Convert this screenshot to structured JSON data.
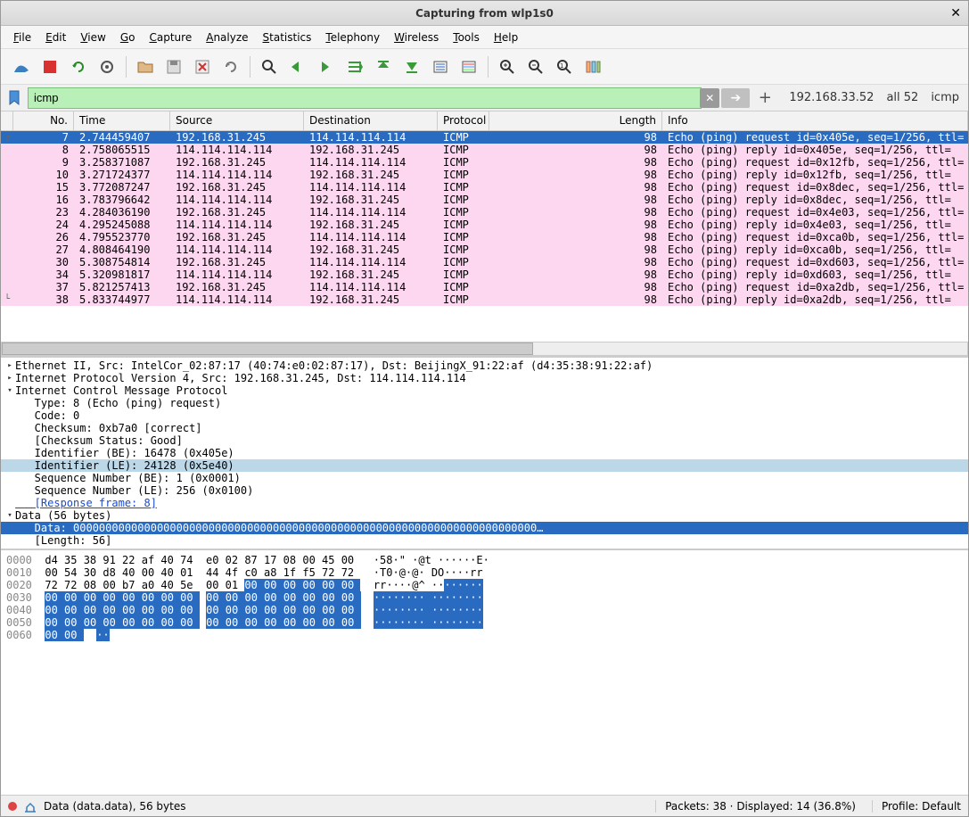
{
  "window": {
    "title": "Capturing from wlp1s0"
  },
  "menu": [
    "File",
    "Edit",
    "View",
    "Go",
    "Capture",
    "Analyze",
    "Statistics",
    "Telephony",
    "Wireless",
    "Tools",
    "Help"
  ],
  "filter": {
    "value": "icmp",
    "status_ip": "192.168.33.52",
    "status_count": "all 52",
    "status_proto": "icmp"
  },
  "columns": {
    "no": "No.",
    "time": "Time",
    "src": "Source",
    "dst": "Destination",
    "proto": "Protocol",
    "len": "Length",
    "info": "Info"
  },
  "packets": [
    {
      "no": "7",
      "time": "2.744459407",
      "src": "192.168.31.245",
      "dst": "114.114.114.114",
      "proto": "ICMP",
      "len": "98",
      "info": "Echo (ping) request  id=0x405e, seq=1/256, ttl=",
      "sel": true
    },
    {
      "no": "8",
      "time": "2.758065515",
      "src": "114.114.114.114",
      "dst": "192.168.31.245",
      "proto": "ICMP",
      "len": "98",
      "info": "Echo (ping) reply    id=0x405e, seq=1/256, ttl="
    },
    {
      "no": "9",
      "time": "3.258371087",
      "src": "192.168.31.245",
      "dst": "114.114.114.114",
      "proto": "ICMP",
      "len": "98",
      "info": "Echo (ping) request  id=0x12fb, seq=1/256, ttl="
    },
    {
      "no": "10",
      "time": "3.271724377",
      "src": "114.114.114.114",
      "dst": "192.168.31.245",
      "proto": "ICMP",
      "len": "98",
      "info": "Echo (ping) reply    id=0x12fb, seq=1/256, ttl="
    },
    {
      "no": "15",
      "time": "3.772087247",
      "src": "192.168.31.245",
      "dst": "114.114.114.114",
      "proto": "ICMP",
      "len": "98",
      "info": "Echo (ping) request  id=0x8dec, seq=1/256, ttl="
    },
    {
      "no": "16",
      "time": "3.783796642",
      "src": "114.114.114.114",
      "dst": "192.168.31.245",
      "proto": "ICMP",
      "len": "98",
      "info": "Echo (ping) reply    id=0x8dec, seq=1/256, ttl="
    },
    {
      "no": "23",
      "time": "4.284036190",
      "src": "192.168.31.245",
      "dst": "114.114.114.114",
      "proto": "ICMP",
      "len": "98",
      "info": "Echo (ping) request  id=0x4e03, seq=1/256, ttl="
    },
    {
      "no": "24",
      "time": "4.295245088",
      "src": "114.114.114.114",
      "dst": "192.168.31.245",
      "proto": "ICMP",
      "len": "98",
      "info": "Echo (ping) reply    id=0x4e03, seq=1/256, ttl="
    },
    {
      "no": "26",
      "time": "4.795523770",
      "src": "192.168.31.245",
      "dst": "114.114.114.114",
      "proto": "ICMP",
      "len": "98",
      "info": "Echo (ping) request  id=0xca0b, seq=1/256, ttl="
    },
    {
      "no": "27",
      "time": "4.808464190",
      "src": "114.114.114.114",
      "dst": "192.168.31.245",
      "proto": "ICMP",
      "len": "98",
      "info": "Echo (ping) reply    id=0xca0b, seq=1/256, ttl="
    },
    {
      "no": "30",
      "time": "5.308754814",
      "src": "192.168.31.245",
      "dst": "114.114.114.114",
      "proto": "ICMP",
      "len": "98",
      "info": "Echo (ping) request  id=0xd603, seq=1/256, ttl="
    },
    {
      "no": "34",
      "time": "5.320981817",
      "src": "114.114.114.114",
      "dst": "192.168.31.245",
      "proto": "ICMP",
      "len": "98",
      "info": "Echo (ping) reply    id=0xd603, seq=1/256, ttl="
    },
    {
      "no": "37",
      "time": "5.821257413",
      "src": "192.168.31.245",
      "dst": "114.114.114.114",
      "proto": "ICMP",
      "len": "98",
      "info": "Echo (ping) request  id=0xa2db, seq=1/256, ttl="
    },
    {
      "no": "38",
      "time": "5.833744977",
      "src": "114.114.114.114",
      "dst": "192.168.31.245",
      "proto": "ICMP",
      "len": "98",
      "info": "Echo (ping) reply    id=0xa2db, seq=1/256, ttl="
    }
  ],
  "details": [
    {
      "indent": 0,
      "twist": "▸",
      "text": "Ethernet II, Src: IntelCor_02:87:17 (40:74:e0:02:87:17), Dst: BeijingX_91:22:af (d4:35:38:91:22:af)"
    },
    {
      "indent": 0,
      "twist": "▸",
      "text": "Internet Protocol Version 4, Src: 192.168.31.245, Dst: 114.114.114.114"
    },
    {
      "indent": 0,
      "twist": "▾",
      "text": "Internet Control Message Protocol"
    },
    {
      "indent": 1,
      "text": "Type: 8 (Echo (ping) request)"
    },
    {
      "indent": 1,
      "text": "Code: 0"
    },
    {
      "indent": 1,
      "text": "Checksum: 0xb7a0 [correct]"
    },
    {
      "indent": 1,
      "text": "[Checksum Status: Good]"
    },
    {
      "indent": 1,
      "text": "Identifier (BE): 16478 (0x405e)"
    },
    {
      "indent": 1,
      "text": "Identifier (LE): 24128 (0x5e40)",
      "sel": "sel1"
    },
    {
      "indent": 1,
      "text": "Sequence Number (BE): 1 (0x0001)"
    },
    {
      "indent": 1,
      "text": "Sequence Number (LE): 256 (0x0100)"
    },
    {
      "indent": 1,
      "text": "[Response frame: 8]",
      "link": true
    },
    {
      "indent": 0,
      "twist": "▾",
      "text": "Data (56 bytes)"
    },
    {
      "indent": 1,
      "text": "Data: 000000000000000000000000000000000000000000000000000000000000000000000000…",
      "sel": "sel2"
    },
    {
      "indent": 1,
      "text": "[Length: 56]"
    }
  ],
  "hex": {
    "rows": [
      {
        "off": "0000",
        "b": "d4 35 38 91 22 af 40 74  e0 02 87 17 08 00 45 00",
        "a": "·58·\" ·@t ······E·",
        "sel": []
      },
      {
        "off": "0010",
        "b": "00 54 30 d8 40 00 40 01  44 4f c0 a8 1f f5 72 72",
        "a": "·T0·@·@· DO····rr",
        "sel": []
      },
      {
        "off": "0020",
        "b": "72 72 08 00 b7 a0 40 5e  00 01 00 00 00 00 00 00",
        "a": "rr····@^ ········",
        "sel": [
          10,
          11,
          12,
          13,
          14,
          15
        ]
      },
      {
        "off": "0030",
        "b": "00 00 00 00 00 00 00 00  00 00 00 00 00 00 00 00",
        "a": "········ ········",
        "sel": "all"
      },
      {
        "off": "0040",
        "b": "00 00 00 00 00 00 00 00  00 00 00 00 00 00 00 00",
        "a": "········ ········",
        "sel": "all"
      },
      {
        "off": "0050",
        "b": "00 00 00 00 00 00 00 00  00 00 00 00 00 00 00 00",
        "a": "········ ········",
        "sel": "all"
      },
      {
        "off": "0060",
        "b": "00 00",
        "a": "··",
        "sel": "all"
      }
    ]
  },
  "status": {
    "field": "Data (data.data), 56 bytes",
    "packets": "Packets: 38 · Displayed: 14 (36.8%)",
    "profile": "Profile: Default"
  }
}
